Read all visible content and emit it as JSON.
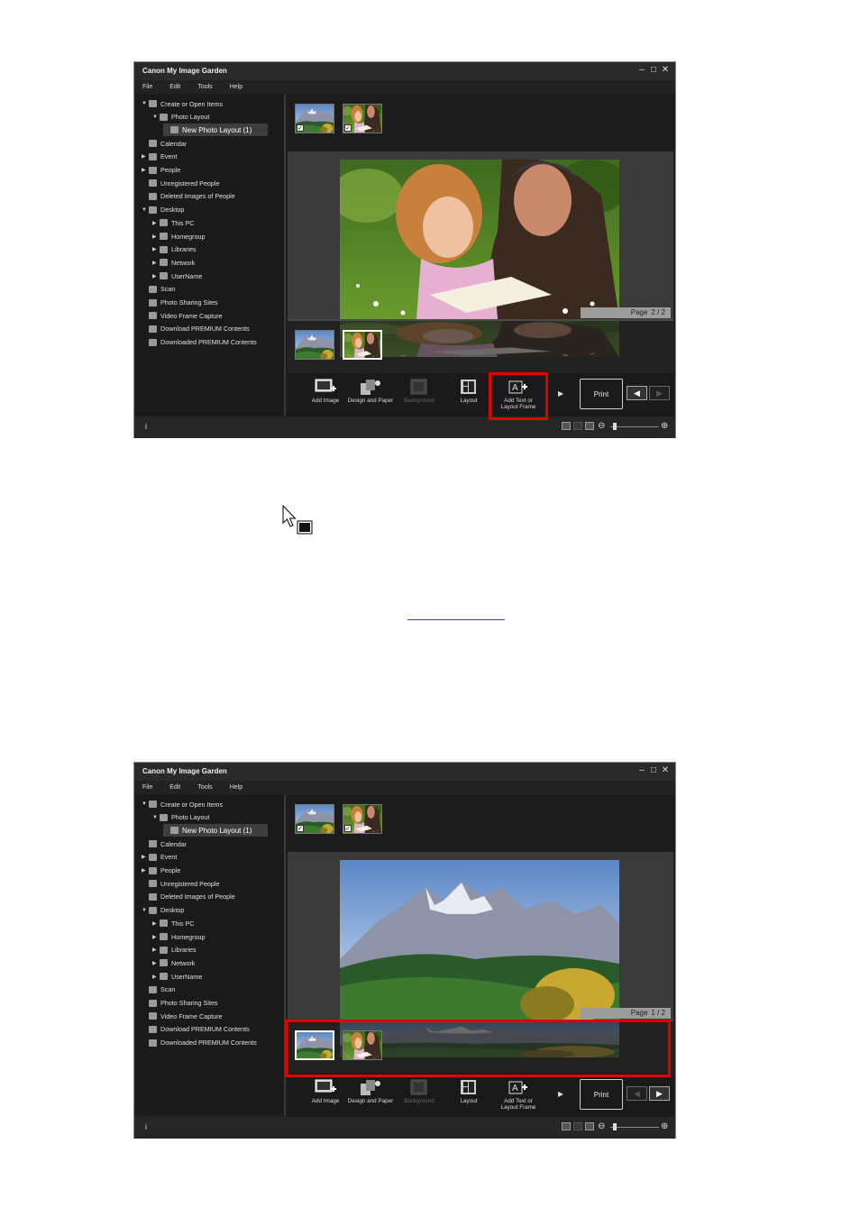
{
  "window_title": "Canon My Image Garden",
  "window_controls": [
    "–",
    "□",
    "✕"
  ],
  "menu": [
    "File",
    "Edit",
    "Tools",
    "Help"
  ],
  "tree": [
    {
      "label": "Create or Open Items",
      "indent": 0,
      "arrow": "▼",
      "icon": "create-items-icon"
    },
    {
      "label": "Photo Layout",
      "indent": 1,
      "arrow": "▼",
      "icon": "photo-layout-icon"
    },
    {
      "label": "New Photo Layout (1)",
      "indent": 2,
      "arrow": "",
      "icon": "layout-item-icon",
      "selected": true
    },
    {
      "label": "Calendar",
      "indent": 0,
      "arrow": "",
      "icon": "calendar-icon"
    },
    {
      "label": "Event",
      "indent": 0,
      "arrow": "▶",
      "icon": "event-icon"
    },
    {
      "label": "People",
      "indent": 0,
      "arrow": "▶",
      "icon": "people-icon"
    },
    {
      "label": "Unregistered People",
      "indent": 0,
      "arrow": "",
      "icon": "unregistered-people-icon"
    },
    {
      "label": "Deleted Images of People",
      "indent": 0,
      "arrow": "",
      "icon": "deleted-people-icon"
    },
    {
      "label": "Desktop",
      "indent": 0,
      "arrow": "▼",
      "icon": "desktop-icon"
    },
    {
      "label": "This PC",
      "indent": 1,
      "arrow": "▶",
      "icon": "this-pc-icon"
    },
    {
      "label": "Homegroup",
      "indent": 1,
      "arrow": "▶",
      "icon": "homegroup-icon"
    },
    {
      "label": "Libraries",
      "indent": 1,
      "arrow": "▶",
      "icon": "libraries-icon"
    },
    {
      "label": "Network",
      "indent": 1,
      "arrow": "▶",
      "icon": "network-icon"
    },
    {
      "label": "UserName",
      "indent": 1,
      "arrow": "▶",
      "icon": "user-folder-icon"
    },
    {
      "label": "Scan",
      "indent": 0,
      "arrow": "",
      "icon": "scan-icon"
    },
    {
      "label": "Photo Sharing Sites",
      "indent": 0,
      "arrow": "",
      "icon": "photo-sharing-icon"
    },
    {
      "label": "Video Frame Capture",
      "indent": 0,
      "arrow": "",
      "icon": "video-frame-icon"
    },
    {
      "label": "Download PREMIUM Contents",
      "indent": 0,
      "arrow": "",
      "icon": "download-premium-icon"
    },
    {
      "label": "Downloaded PREMIUM Contents",
      "indent": 0,
      "arrow": "",
      "icon": "downloaded-premium-icon"
    }
  ],
  "toolbar": {
    "add_image": "Add Image",
    "design_paper": "Design and Paper",
    "background": "Background",
    "layout": "Layout",
    "add_text": "Add Text or Layout Frame",
    "print": "Print",
    "prev_icon": "prev-page-icon",
    "next_icon": "next-page-icon"
  },
  "status": {
    "info_icon": "i"
  },
  "screens": [
    {
      "page_label": "Page",
      "page_num": "2 / 2",
      "main_photo": "family",
      "active_thumb": 1,
      "prev_enabled": true,
      "next_enabled": false
    },
    {
      "page_label": "Page",
      "page_num": "1 / 2",
      "main_photo": "mountain",
      "active_thumb": 0,
      "prev_enabled": false,
      "next_enabled": true
    }
  ],
  "colors": {
    "highlight": "#e10000",
    "link": "#1a47d0",
    "window_bg": "#1e1e1e"
  },
  "cursor_icon": "pointer-with-box-icon"
}
